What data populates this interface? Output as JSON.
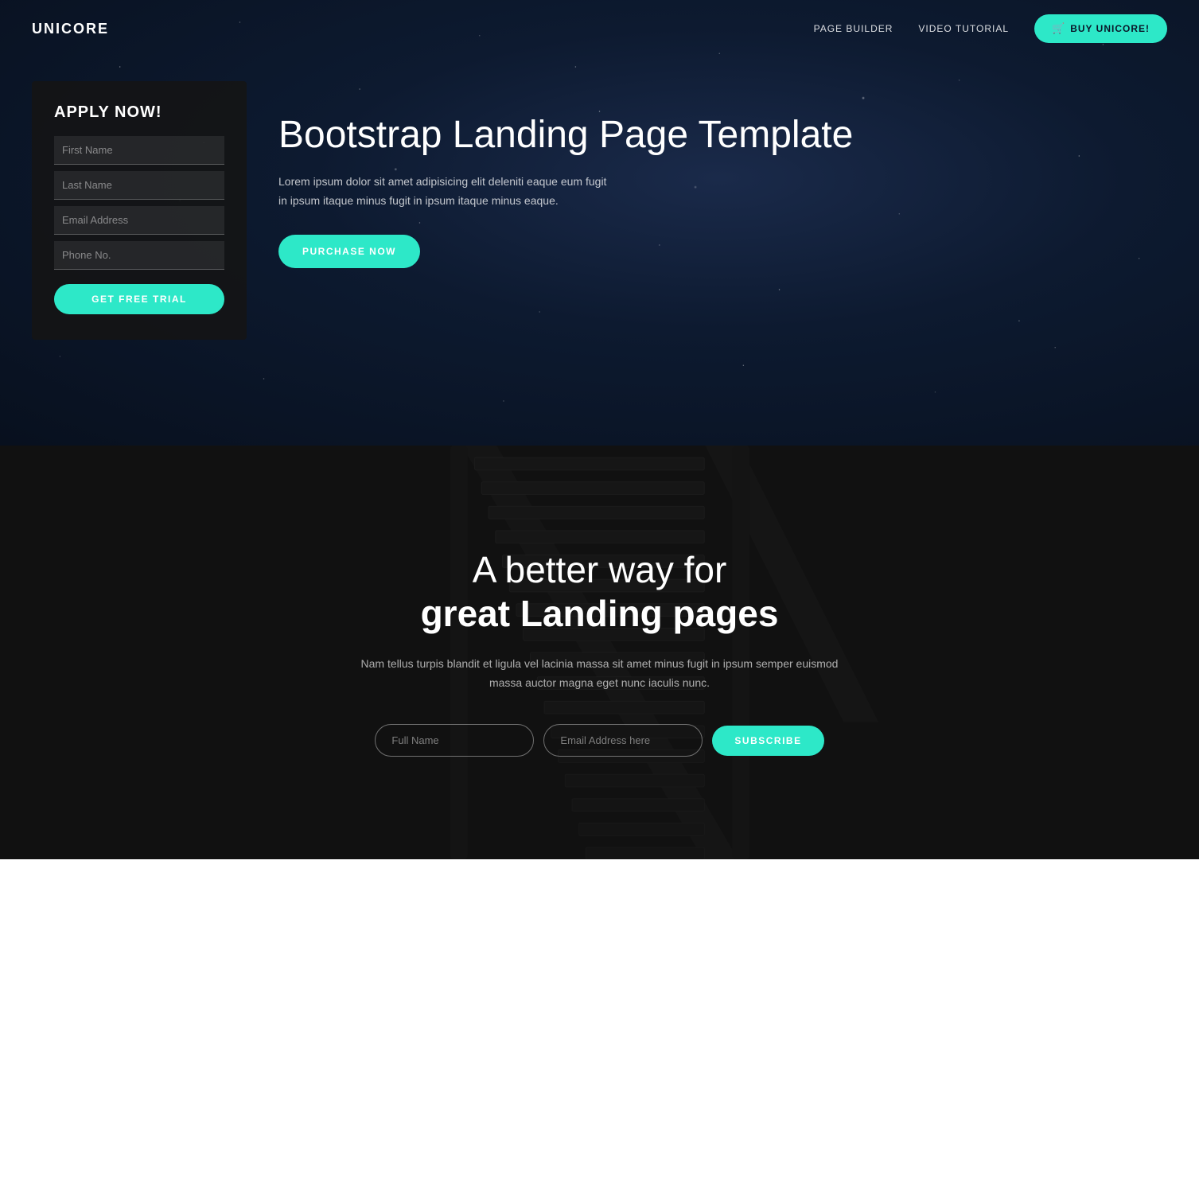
{
  "navbar": {
    "logo": "UNICORE",
    "links": [
      {
        "id": "page-builder",
        "label": "PAGE BUILDER"
      },
      {
        "id": "video-tutorial",
        "label": "VIDEO TUTORIAL"
      }
    ],
    "cta_button": "BUY UNICORE!",
    "cta_icon": "🛒"
  },
  "hero": {
    "form": {
      "title": "APPLY NOW!",
      "fields": [
        {
          "id": "first-name",
          "placeholder": "First Name"
        },
        {
          "id": "last-name",
          "placeholder": "Last Name"
        },
        {
          "id": "email",
          "placeholder": "Email Address"
        },
        {
          "id": "phone",
          "placeholder": "Phone No."
        }
      ],
      "button": "GET FREE TRIAL"
    },
    "heading": "Bootstrap Landing Page Template",
    "description": "Lorem ipsum dolor sit amet adipisicing elit deleniti eaque eum fugit in ipsum itaque minus fugit in ipsum itaque minus eaque.",
    "purchase_button": "PURCHASE NOW"
  },
  "escalator": {
    "heading_line1": "A better way for",
    "heading_line2": "great Landing pages",
    "description": "Nam tellus turpis blandit et ligula vel lacinia massa sit amet minus fugit in ipsum semper euismod massa auctor magna eget nunc iaculis nunc.",
    "full_name_placeholder": "Full Name",
    "email_placeholder": "Email Address here",
    "subscribe_button": "SUBSCRIBE"
  },
  "colors": {
    "accent": "#2de8c8",
    "hero_bg": "#0a1628",
    "dark_bg": "#111111"
  }
}
